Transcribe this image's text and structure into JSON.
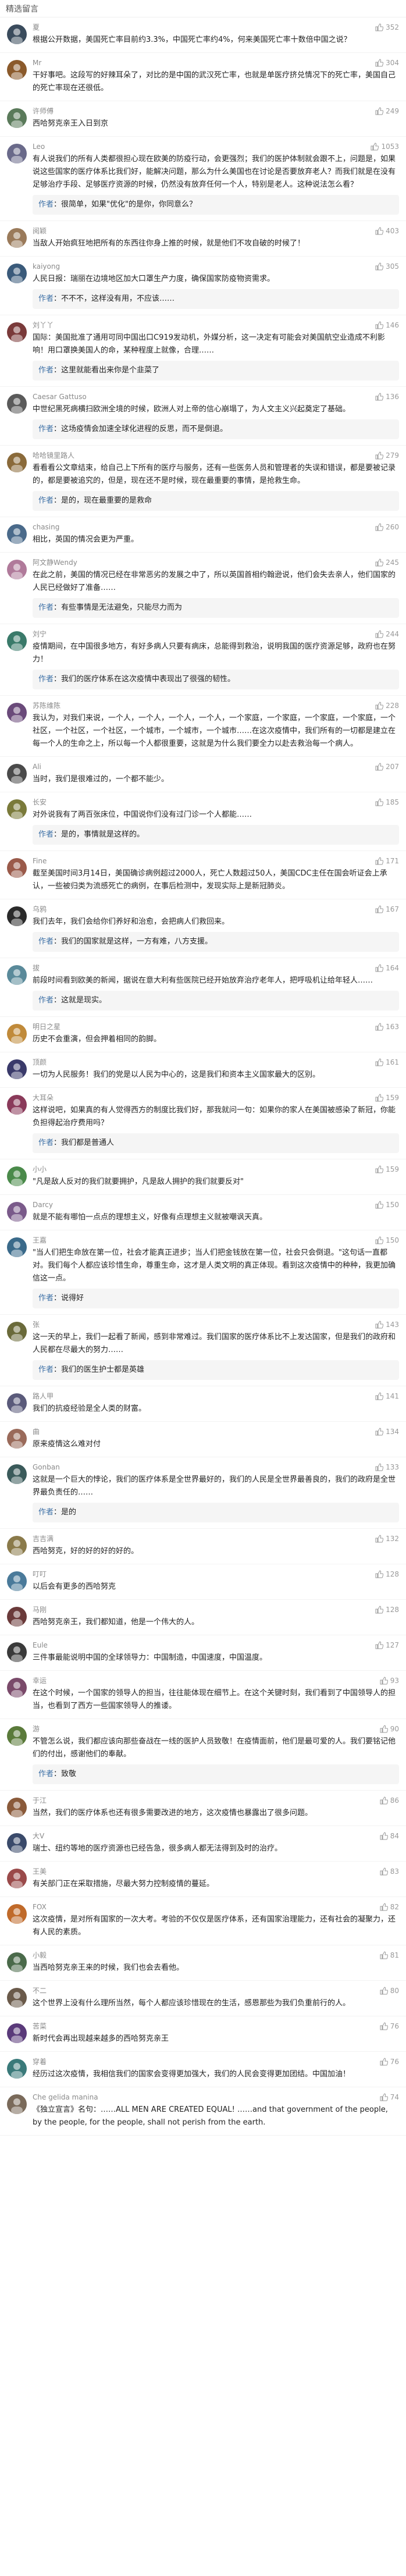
{
  "header": {
    "title": "精选留言"
  },
  "icons": {
    "like": "thumbs-up-icon"
  },
  "comments": [
    {
      "username": "夏",
      "likes": "352",
      "content": "根据公开数据，美国死亡率目前约3.3%，中国死亡率约4%，何来美国死亡率十数倍中国之说？",
      "reply": {
        "who": "",
        "text": ""
      },
      "avatarColor": "#3a4b5c"
    },
    {
      "username": "Mr",
      "likes": "304",
      "content": "干好事吧。这段写的好辣耳朵了，对比的是中国的武汉死亡率，也就是单医疗挤兑情况下的死亡率，美国自己的死亡率现在还很低。",
      "reply": {
        "who": "",
        "text": ""
      },
      "avatarColor": "#8b5a2b"
    },
    {
      "username": "许师傅",
      "likes": "249",
      "content": "西哈努克亲王入日到京",
      "reply": {
        "who": "",
        "text": ""
      },
      "avatarColor": "#5a7a5a"
    },
    {
      "username": "Leo",
      "likes": "1053",
      "content": "有人说我们的所有人类都很担心现在欧美的防疫行动，会更强烈；我们的医护体制就会跟不上，问题是，如果说这些国家的医疗体系比我们好，能解决问题，那么为什么美国也在讨论是否要放弃老人？而我们就是在没有足够治疗手段、足够医疗资源的时候，仍然没有放弃任何一个人，特别是老人。这种说法怎么看？",
      "reply": {
        "who": "作者",
        "text": "很简单，如果\"优化\"的是你，你同意么？"
      },
      "avatarColor": "#6a6a8a"
    },
    {
      "username": "阅颖",
      "likes": "403",
      "content": "当敌人开始疯狂地把所有的东西往你身上推的时候，就是他们不攻自破的时候了！",
      "reply": {
        "who": "",
        "text": ""
      },
      "avatarColor": "#9a7a5a"
    },
    {
      "username": "kaiyong",
      "likes": "305",
      "content": "人民日报：瑞丽在边境地区加大口罩生产力度，确保国家防疫物资需求。",
      "reply": {
        "who": "作者",
        "text": "不不不，这样没有用，不应该……"
      },
      "avatarColor": "#3a5a7a"
    },
    {
      "username": "刘丫丫",
      "likes": "146",
      "content": "国际：美国批准了通用可同中国出口C919发动机，外媒分析，这一决定有可能会对美国航空业造成不利影响！用口罩换美国人的命，某种程度上就像，合理……",
      "reply": {
        "who": "作者",
        "text": "这里就能看出来你是个韭菜了"
      },
      "avatarColor": "#7a3a3a"
    },
    {
      "username": "Caesar Gattuso",
      "likes": "136",
      "content": "中世纪黑死病横扫欧洲全境的时候，欧洲人对上帝的信心崩塌了，为人文主义兴起奠定了基础。",
      "reply": {
        "who": "作者",
        "text": "这场疫情会加速全球化进程的反思，而不是倒退。"
      },
      "avatarColor": "#5a5a5a"
    },
    {
      "username": "哈哈镜里路人",
      "likes": "279",
      "content": "看看看公文章结束，给自己上下所有的医疗与服务，还有一些医务人员和管理者的失误和错误，都是要被记录的，都是要被追究的，但是，现在还不是时候，现在最重要的事情，是抢救生命。",
      "reply": {
        "who": "作者",
        "text": "是的，现在最重要的是救命"
      },
      "avatarColor": "#8a6a3a"
    },
    {
      "username": "chasing",
      "likes": "260",
      "content": "相比，英国的情况会更为严重。",
      "reply": {
        "who": "",
        "text": ""
      },
      "avatarColor": "#4a6a8a"
    },
    {
      "username": "阿文静Wendy",
      "likes": "245",
      "content": "在此之前，美国的情况已经在非常恶劣的发展之中了，所以英国首相约翰逊说，他们会失去亲人，他们国家的人民已经做好了准备……",
      "reply": {
        "who": "作者",
        "text": "有些事情是无法避免，只能尽力而为"
      },
      "avatarColor": "#b07a9a"
    },
    {
      "username": "刘宁",
      "likes": "244",
      "content": "疫情期间，在中国很多地方，有好多病人只要有病床，总能得到救治，说明我国的医疗资源足够，政府也在努力！",
      "reply": {
        "who": "作者",
        "text": "我们的医疗体系在这次疫情中表现出了很强的韧性。"
      },
      "avatarColor": "#3a7a6a"
    },
    {
      "username": "苏陈维陈",
      "likes": "228",
      "content": "我认为，对我们来说，一个人，一个人，一个人，一个人，一个家庭，一个家庭，一个家庭，一个家庭，一个社区，一个社区，一个社区，一个城市，一个城市，一个城市……在这次疫情中，我们所有的一切都是建立在每一个人的生命之上，所以每一个人都很重要，这就是为什么我们要全力以赴去救治每一个病人。",
      "reply": {
        "who": "",
        "text": ""
      },
      "avatarColor": "#6a4a7a"
    },
    {
      "username": "Ali",
      "likes": "207",
      "content": "当时，我们是很难过的，一个都不能少。",
      "reply": {
        "who": "",
        "text": ""
      },
      "avatarColor": "#4a4a4a"
    },
    {
      "username": "长安",
      "likes": "185",
      "content": "对外说我有了两百张床位，中国说你们没有过门诊一个人都能……",
      "reply": {
        "who": "作者",
        "text": "是的，事情就是这样的。"
      },
      "avatarColor": "#7a7a3a"
    },
    {
      "username": "Fine",
      "likes": "171",
      "content": "截至美国时间3月14日，美国确诊病例超过2000人，死亡人数超过50人，美国CDC主任在国会听证会上承认，一些被归类为流感死亡的病例，在事后检测中，发现实际上是新冠肺炎。",
      "reply": {
        "who": "",
        "text": ""
      },
      "avatarColor": "#9a5a4a"
    },
    {
      "username": "乌鸦",
      "likes": "167",
      "content": "我们去年，我们会给你们养好和治愈，会把病人们救回来。",
      "reply": {
        "who": "作者",
        "text": "我们的国家就是这样，一方有难，八方支援。"
      },
      "avatarColor": "#2a2a2a"
    },
    {
      "username": "拔",
      "likes": "164",
      "content": "前段时间看到欧美的新闻，据说在意大利有些医院已经开始放弃治疗老年人，把呼吸机让给年轻人……",
      "reply": {
        "who": "作者",
        "text": "这就是现实。"
      },
      "avatarColor": "#5a8a9a"
    },
    {
      "username": "明日之星",
      "likes": "163",
      "content": "历史不会重演，但会押着相同的韵脚。",
      "reply": {
        "who": "",
        "text": ""
      },
      "avatarColor": "#c08a3a"
    },
    {
      "username": "顶颜",
      "likes": "161",
      "content": "一切为人民服务！我们的党是以人民为中心的，这是我们和资本主义国家最大的区别。",
      "reply": {
        "who": "",
        "text": ""
      },
      "avatarColor": "#3a3a6a"
    },
    {
      "username": "大耳朵",
      "likes": "159",
      "content": "这样说吧，如果真的有人觉得西方的制度比我们好，那我就问一句：如果你的家人在美国被感染了新冠，你能负担得起治疗费用吗？",
      "reply": {
        "who": "作者",
        "text": "我们都是普通人"
      },
      "avatarColor": "#8a3a5a"
    },
    {
      "username": "小小",
      "likes": "159",
      "content": "\"凡是敌人反对的我们就要拥护，凡是敌人拥护的我们就要反对\"",
      "reply": {
        "who": "",
        "text": ""
      },
      "avatarColor": "#4a8a4a"
    },
    {
      "username": "Darcy",
      "likes": "150",
      "content": "就是不能有哪怕一点点的理想主义，好像有点理想主义就被嘲讽天真。",
      "reply": {
        "who": "",
        "text": ""
      },
      "avatarColor": "#7a5a8a"
    },
    {
      "username": "王嘉",
      "likes": "150",
      "content": "\"当人们把生命放在第一位，社会才能真正进步；当人们把金钱放在第一位，社会只会倒退。\"这句话一直都对。我们每个人都应该珍惜生命，尊重生命，这才是人类文明的真正体现。看到这次疫情中的种种，我更加确信这一点。",
      "reply": {
        "who": "作者",
        "text": "说得好"
      },
      "avatarColor": "#3a6a8a"
    },
    {
      "username": "张",
      "likes": "143",
      "content": "这一天的早上，我们一起看了新闻，感到非常难过。我们国家的医疗体系比不上发达国家，但是我们的政府和人民都在尽最大的努力……",
      "reply": {
        "who": "作者",
        "text": "我们的医生护士都是英雄"
      },
      "avatarColor": "#6a6a3a"
    },
    {
      "username": "路人甲",
      "likes": "141",
      "content": "我们的抗疫经验是全人类的财富。",
      "reply": {
        "who": "",
        "text": ""
      },
      "avatarColor": "#5a5a7a"
    },
    {
      "username": "曲",
      "likes": "134",
      "content": "原来疫情这么难对付",
      "reply": {
        "who": "",
        "text": ""
      },
      "avatarColor": "#9a6a5a"
    },
    {
      "username": "Gonban",
      "likes": "133",
      "content": "这就是一个巨大的悖论，我们的医疗体系是全世界最好的，我们的人民是全世界最善良的，我们的政府是全世界最负责任的……",
      "reply": {
        "who": "作者",
        "text": "是的"
      },
      "avatarColor": "#3a5a5a"
    },
    {
      "username": "吉吉满",
      "likes": "132",
      "content": "西哈努克，好的好的好的好的。",
      "reply": {
        "who": "",
        "text": ""
      },
      "avatarColor": "#8a7a4a"
    },
    {
      "username": "叮叮",
      "likes": "128",
      "content": "以后会有更多的西哈努克",
      "reply": {
        "who": "",
        "text": ""
      },
      "avatarColor": "#4a7a9a"
    },
    {
      "username": "马刚",
      "likes": "128",
      "content": "西哈努克亲王，我们都知道，他是一个伟大的人。",
      "reply": {
        "who": "",
        "text": ""
      },
      "avatarColor": "#6a3a3a"
    },
    {
      "username": "Eule",
      "likes": "127",
      "content": "三件事最能说明中国的全球领导力：中国制造，中国速度，中国温度。",
      "reply": {
        "who": "",
        "text": ""
      },
      "avatarColor": "#3a3a3a"
    },
    {
      "username": "幸运",
      "likes": "93",
      "content": "在这个时候，一个国家的领导人的担当，往往能体现在细节上。在这个关键时刻，我们看到了中国领导人的担当，也看到了西方一些国家领导人的推诿。",
      "reply": {
        "who": "",
        "text": ""
      },
      "avatarColor": "#7a4a6a"
    },
    {
      "username": "游",
      "likes": "90",
      "content": "不管怎么说，我们都应该向那些奋战在一线的医护人员致敬！在疫情面前，他们是最可爱的人。我们要铭记他们的付出，感谢他们的奉献。",
      "reply": {
        "who": "作者",
        "text": "致敬"
      },
      "avatarColor": "#5a7a3a"
    },
    {
      "username": "于江",
      "likes": "86",
      "content": "当然，我们的医疗体系也还有很多需要改进的地方，这次疫情也暴露出了很多问题。",
      "reply": {
        "who": "",
        "text": ""
      },
      "avatarColor": "#8a5a3a"
    },
    {
      "username": "大V",
      "likes": "84",
      "content": "瑞士、纽约等地的医疗资源也已经告急，很多病人都无法得到及时的治疗。",
      "reply": {
        "who": "",
        "text": ""
      },
      "avatarColor": "#3a4a6a"
    },
    {
      "username": "王美",
      "likes": "83",
      "content": "有关部门正在采取措施，尽最大努力控制疫情的蔓延。",
      "reply": {
        "who": "",
        "text": ""
      },
      "avatarColor": "#9a4a4a"
    },
    {
      "username": "FOX",
      "likes": "82",
      "content": "这次疫情，是对所有国家的一次大考。考验的不仅仅是医疗体系，还有国家治理能力，还有社会的凝聚力，还有人民的素质。",
      "reply": {
        "who": "",
        "text": ""
      },
      "avatarColor": "#c06a2a"
    },
    {
      "username": "小毅",
      "likes": "81",
      "content": "当西哈努克亲王来的时候，我们也会去看他。",
      "reply": {
        "who": "",
        "text": ""
      },
      "avatarColor": "#4a6a4a"
    },
    {
      "username": "不二",
      "likes": "80",
      "content": "这个世界上没有什么理所当然，每个人都应该珍惜现在的生活，感恩那些为我们负重前行的人。",
      "reply": {
        "who": "",
        "text": ""
      },
      "avatarColor": "#6a5a4a"
    },
    {
      "username": "苦菜",
      "likes": "76",
      "content": "新时代会再出现越来越多的西哈努克亲王",
      "reply": {
        "who": "",
        "text": ""
      },
      "avatarColor": "#5a3a7a"
    },
    {
      "username": "穿着",
      "likes": "76",
      "content": "经历过这次疫情，我相信我们的国家会变得更加强大，我们的人民会变得更加团结。中国加油！",
      "reply": {
        "who": "",
        "text": ""
      },
      "avatarColor": "#3a7a7a"
    },
    {
      "username": "Che gelida manina",
      "likes": "74",
      "content": "《独立宣言》名句：……ALL MEN ARE CREATED EQUAL! ……and that government of the people, by the people, for the people, shall not perish from the earth.",
      "reply": {
        "who": "",
        "text": ""
      },
      "avatarColor": "#7a6a5a"
    }
  ]
}
